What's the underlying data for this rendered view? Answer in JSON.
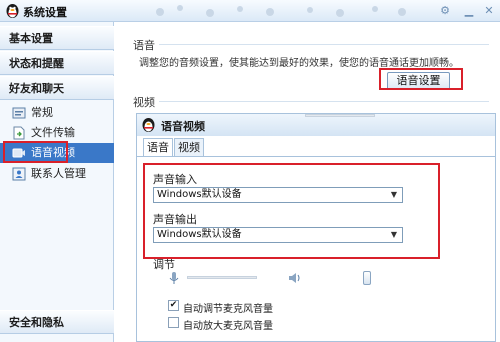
{
  "window": {
    "title": "系统设置"
  },
  "sidebar": {
    "headers": [
      {
        "label": "基本设置"
      },
      {
        "label": "状态和提醒"
      },
      {
        "label": "好友和聊天"
      }
    ],
    "items": [
      {
        "label": "常规",
        "icon": "general-settings-icon"
      },
      {
        "label": "文件传输",
        "icon": "file-transfer-icon"
      },
      {
        "label": "语音视频",
        "icon": "voice-video-icon",
        "selected": true
      },
      {
        "label": "联系人管理",
        "icon": "contacts-icon"
      }
    ],
    "footer": {
      "label": "安全和隐私"
    }
  },
  "voice_section": {
    "label": "语音",
    "description": "调整您的音频设置，使其能达到最好的效果，使您的语音通话更加顺畅。",
    "button_label": "语音设置"
  },
  "video_section": {
    "label": "视频"
  },
  "voice_video_panel": {
    "title": "语音视频",
    "tabs": [
      {
        "label": "语音",
        "active": true
      },
      {
        "label": "视频",
        "active": false
      }
    ],
    "input_label": "声音输入",
    "input_value": "Windows默认设备",
    "output_label": "声音输出",
    "output_value": "Windows默认设备",
    "adjust_label": "调节",
    "checkboxes": [
      {
        "label": "自动调节麦克风音量",
        "checked": true
      },
      {
        "label": "自动放大麦克风音量",
        "checked": false
      }
    ]
  },
  "colors": {
    "highlight_box": "#d9202a",
    "selected_item": "#3a78c8"
  }
}
